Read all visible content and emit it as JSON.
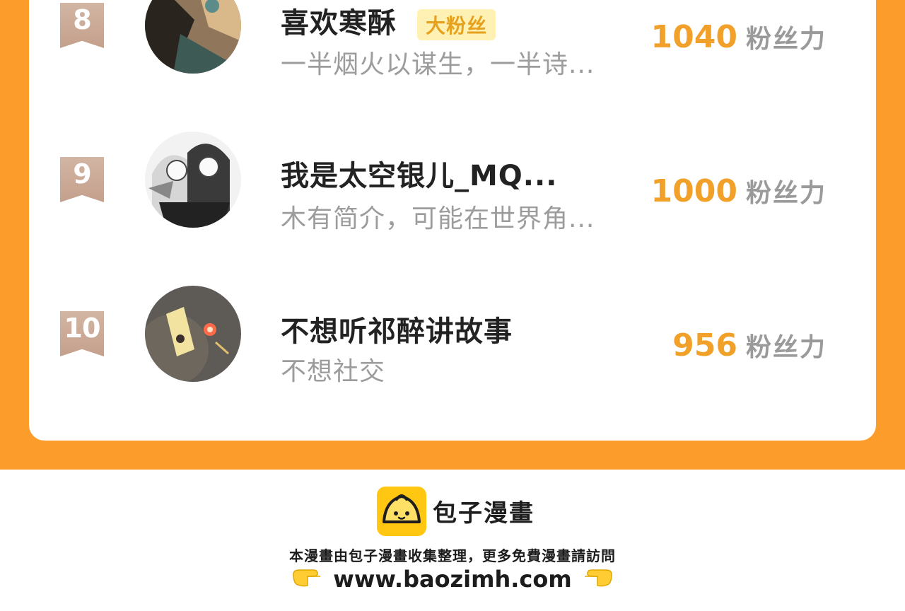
{
  "ranking": {
    "rows": [
      {
        "rank": "8",
        "name": "喜欢寒酥",
        "badge": "大粉丝",
        "description": "一半烟火以谋生，一半诗...",
        "score": "1040",
        "unit": "粉丝力"
      },
      {
        "rank": "9",
        "name": "我是太空银儿_MQ...",
        "badge": "",
        "description": "木有简介，可能在世界角...",
        "score": "1000",
        "unit": "粉丝力"
      },
      {
        "rank": "10",
        "name": "不想听祁醉讲故事",
        "badge": "",
        "description": "不想社交",
        "score": "956",
        "unit": "粉丝力"
      }
    ]
  },
  "footer": {
    "logo_text": "包子漫畫",
    "notice": "本漫畫由包子漫畫收集整理，更多免費漫畫請訪問",
    "url": "www.baozimh.com",
    "icons": [
      "baozi-logo-icon",
      "pointing-right-hand-icon",
      "pointing-left-hand-icon"
    ]
  },
  "colors": {
    "orange_band": "#fc9c2a",
    "score": "#f1a12a",
    "rank_badge": "#c9a691",
    "logo_bg": "#ffc712"
  }
}
